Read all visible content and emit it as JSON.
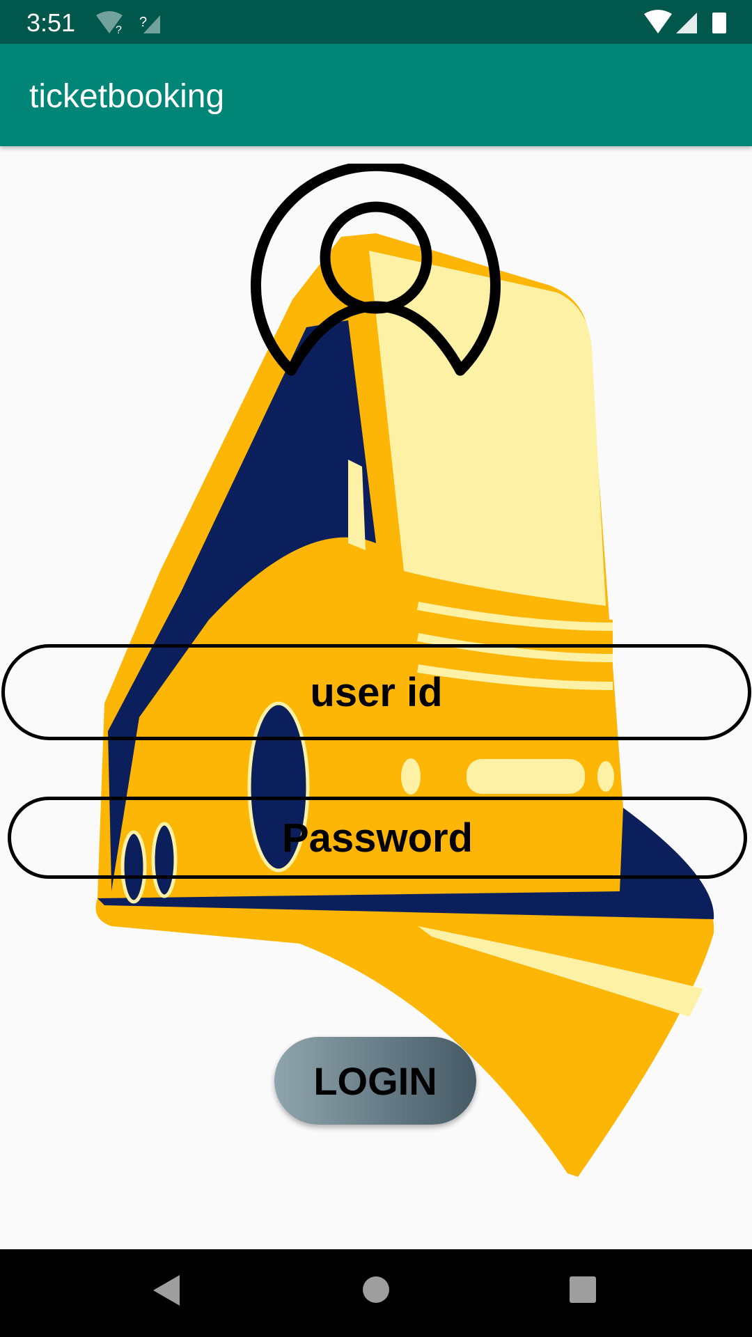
{
  "status_bar": {
    "time": "3:51"
  },
  "app_bar": {
    "title": "ticketbooking"
  },
  "form": {
    "user_id_hint": "user id",
    "password_hint": "Password",
    "login_label": "LOGIN"
  },
  "colors": {
    "status": "#00574b",
    "primary": "#008577",
    "bus_yellow": "#fdb606",
    "bus_navy": "#0b1f5c",
    "bus_glass": "#fdf1a6"
  }
}
